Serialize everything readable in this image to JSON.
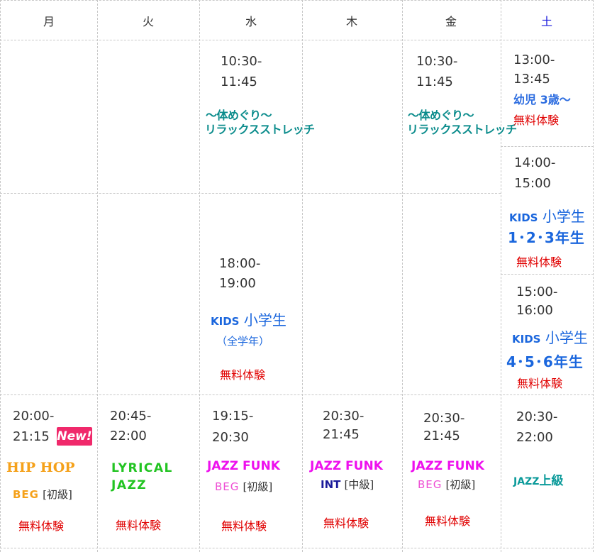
{
  "days": [
    "月",
    "火",
    "水",
    "木",
    "金",
    "土"
  ],
  "morning": {
    "wed": {
      "start": "10:30-",
      "end": "11:45",
      "line1": "～体めぐり～",
      "line2": "リラックスストレッチ"
    },
    "fri": {
      "start": "10:30-",
      "end": "11:45",
      "line1": "～体めぐり～",
      "line2": "リラックスストレッチ"
    },
    "sat1": {
      "start": "13:00-",
      "end": "13:45",
      "title": "幼児 3歳～",
      "trial": "無料体験"
    }
  },
  "afternoon": {
    "sat2": {
      "start": "14:00-",
      "end": "15:00",
      "kids": "KIDS",
      "kids_label": "小学生",
      "grades": "1･2･3年生",
      "trial": "無料体験"
    },
    "wed": {
      "start": "18:00-",
      "end": "19:00",
      "kids": "KIDS",
      "kids_label": "小学生",
      "sub": "（全学年）",
      "trial": "無料体験"
    },
    "sat3": {
      "start": "15:00-",
      "end": "16:00",
      "kids": "KIDS",
      "kids_label": "小学生",
      "grades": "4･5･6年生",
      "trial": "無料体験"
    }
  },
  "evening": {
    "mon": {
      "start": "20:00-",
      "end": "21:15",
      "badge": "New!",
      "class": "HIP HOP",
      "level_code": "BEG",
      "level": "[初級]",
      "trial": "無料体験"
    },
    "tue": {
      "start": "20:45-",
      "end": "22:00",
      "class1": "LYRICAL",
      "class2": "JAZZ",
      "trial": "無料体験"
    },
    "wed": {
      "start": "19:15-",
      "end": "20:30",
      "class": "JAZZ FUNK",
      "level_code": "BEG",
      "level": "[初級]",
      "trial": "無料体験"
    },
    "thu": {
      "start": "20:30-",
      "end": "21:45",
      "class": "JAZZ FUNK",
      "level_code": "INT",
      "level": "[中級]",
      "trial": "無料体験"
    },
    "fri": {
      "start": "20:30-",
      "end": "21:45",
      "class": "JAZZ FUNK",
      "level_code": "BEG",
      "level": "[初級]",
      "trial": "無料体験"
    },
    "sat": {
      "start": "20:30-",
      "end": "22:00",
      "class_prefix": "JAZZ",
      "class_suffix": "上級"
    }
  }
}
